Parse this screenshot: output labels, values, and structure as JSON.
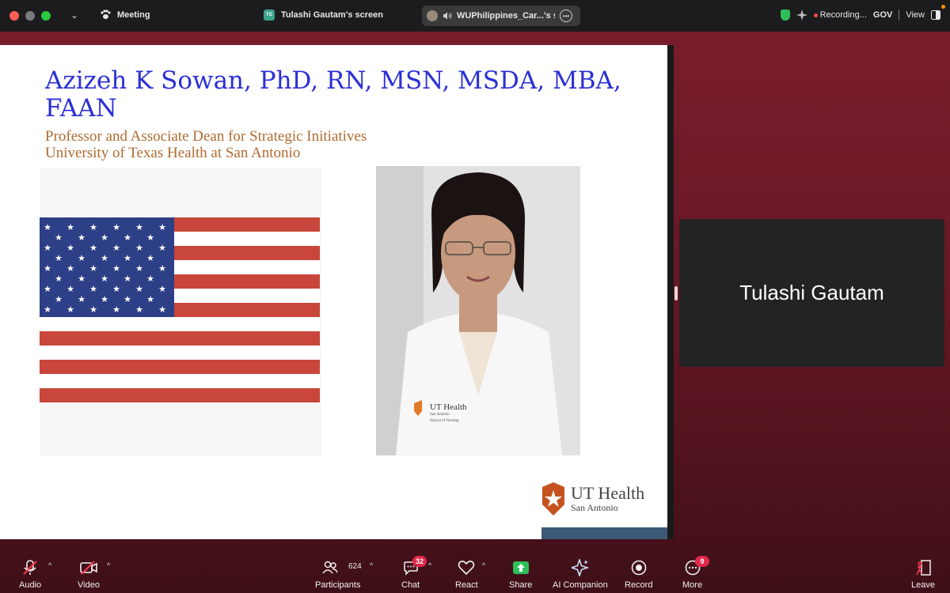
{
  "topbar": {
    "meeting_label": "Meeting",
    "screen_initials": "TG",
    "screen_title": "Tulashi Gautam's screen",
    "share_pill_label": "WUPhilippines_Car...'s sc",
    "recording_label": "Recording...",
    "gov_label": "GOV",
    "view_label": "View"
  },
  "slide": {
    "title": "Azizeh K Sowan, PhD, RN, MSN, MSDA, MBA, FAAN",
    "subtitle_line1": "Professor and Associate Dean for Strategic Initiatives",
    "subtitle_line2": "University of Texas Health at San Antonio",
    "logo_main": "UT Health",
    "logo_sub": "San Antonio",
    "badge_main": "UT Health",
    "badge_sub": "San Antonio",
    "badge_school": "School of Nursing"
  },
  "participant_tile": {
    "name": "Tulashi Gautam"
  },
  "toolbar": {
    "audio": "Audio",
    "video": "Video",
    "participants": "Participants",
    "participants_count": "624",
    "chat": "Chat",
    "chat_badge": "32",
    "react": "React",
    "share": "Share",
    "ai_companion": "AI Companion",
    "record": "Record",
    "more": "More",
    "more_badge": "9",
    "leave": "Leave"
  },
  "colors": {
    "title_blue": "#2b2fd6",
    "subtitle_brown": "#b06b2f",
    "share_green": "#2fbf5a",
    "badge_red": "#e0284a"
  }
}
